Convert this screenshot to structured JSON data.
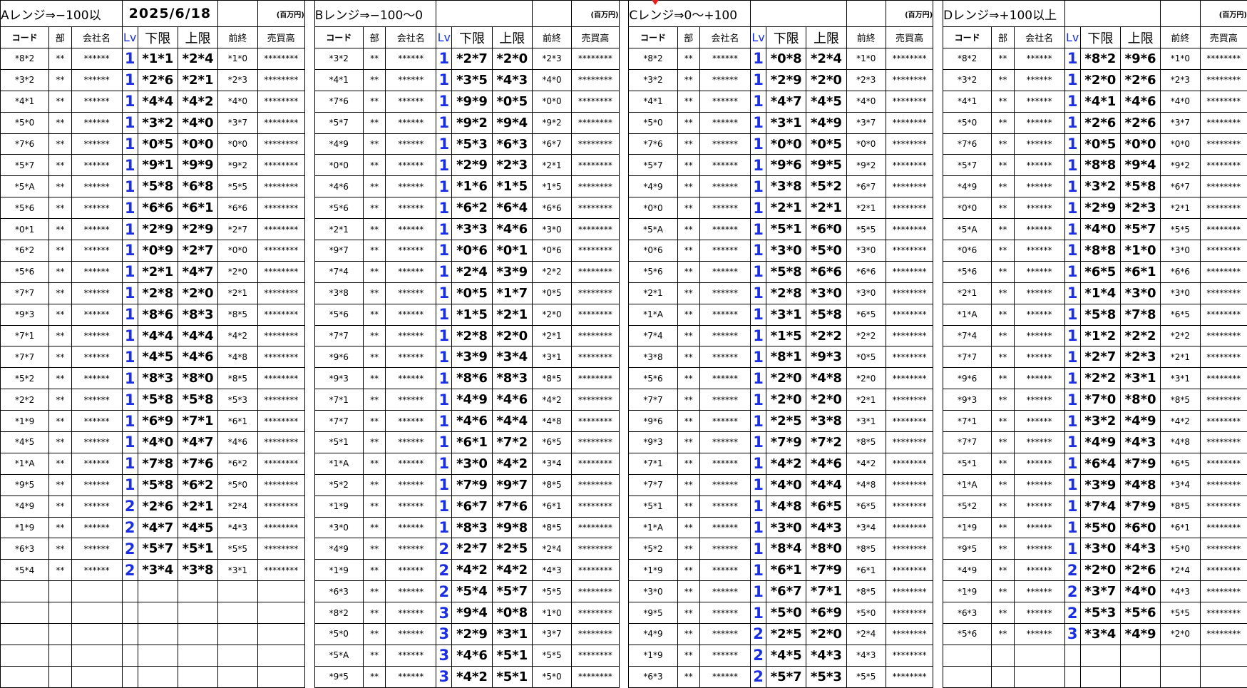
{
  "date": "2025/6/18",
  "unit": "(百万円)",
  "headers": {
    "code": "コード",
    "bu": "部",
    "name": "会社名",
    "lv": "Lv",
    "lo": "下限",
    "hi": "上限",
    "pc": "前終",
    "sale": "売買高"
  },
  "masks": {
    "bu": "**",
    "name": "******",
    "sale": "********"
  },
  "blocks": [
    {
      "title": "Aレンジ⇒−100以",
      "rows": [
        {
          "code": "*8*2",
          "lv": "1",
          "lo": "*1*1",
          "hi": "*2*4",
          "pc": "*1*0"
        },
        {
          "code": "*3*2",
          "lv": "1",
          "lo": "*2*6",
          "hi": "*2*1",
          "pc": "*2*3"
        },
        {
          "code": "*4*1",
          "lv": "1",
          "lo": "*4*4",
          "hi": "*4*2",
          "pc": "*4*0"
        },
        {
          "code": "*5*0",
          "lv": "1",
          "lo": "*3*2",
          "hi": "*4*0",
          "pc": "*3*7"
        },
        {
          "code": "*7*6",
          "lv": "1",
          "lo": "*0*5",
          "hi": "*0*0",
          "pc": "*0*0"
        },
        {
          "code": "*5*7",
          "lv": "1",
          "lo": "*9*1",
          "hi": "*9*9",
          "pc": "*9*2"
        },
        {
          "code": "*5*A",
          "lv": "1",
          "lo": "*5*8",
          "hi": "*6*8",
          "pc": "*5*5"
        },
        {
          "code": "*5*6",
          "lv": "1",
          "lo": "*6*6",
          "hi": "*6*1",
          "pc": "*6*6"
        },
        {
          "code": "*0*1",
          "lv": "1",
          "lo": "*2*9",
          "hi": "*2*9",
          "pc": "*2*7"
        },
        {
          "code": "*6*2",
          "lv": "1",
          "lo": "*0*9",
          "hi": "*2*7",
          "pc": "*0*0"
        },
        {
          "code": "*5*6",
          "lv": "1",
          "lo": "*2*1",
          "hi": "*4*7",
          "pc": "*2*0"
        },
        {
          "code": "*7*7",
          "lv": "1",
          "lo": "*2*8",
          "hi": "*2*0",
          "pc": "*2*1"
        },
        {
          "code": "*9*3",
          "lv": "1",
          "lo": "*8*6",
          "hi": "*8*3",
          "pc": "*8*5"
        },
        {
          "code": "*7*1",
          "lv": "1",
          "lo": "*4*4",
          "hi": "*4*4",
          "pc": "*4*2"
        },
        {
          "code": "*7*7",
          "lv": "1",
          "lo": "*4*5",
          "hi": "*4*6",
          "pc": "*4*8"
        },
        {
          "code": "*5*2",
          "lv": "1",
          "lo": "*8*3",
          "hi": "*8*0",
          "pc": "*8*5"
        },
        {
          "code": "*2*2",
          "lv": "1",
          "lo": "*5*8",
          "hi": "*5*8",
          "pc": "*5*3"
        },
        {
          "code": "*1*9",
          "lv": "1",
          "lo": "*6*9",
          "hi": "*7*1",
          "pc": "*6*1"
        },
        {
          "code": "*4*5",
          "lv": "1",
          "lo": "*4*0",
          "hi": "*4*7",
          "pc": "*4*6"
        },
        {
          "code": "*1*A",
          "lv": "1",
          "lo": "*7*8",
          "hi": "*7*6",
          "pc": "*6*2"
        },
        {
          "code": "*9*5",
          "lv": "1",
          "lo": "*5*8",
          "hi": "*6*2",
          "pc": "*5*0"
        },
        {
          "code": "*4*9",
          "lv": "2",
          "lo": "*2*6",
          "hi": "*2*1",
          "pc": "*2*4"
        },
        {
          "code": "*1*9",
          "lv": "2",
          "lo": "*4*7",
          "hi": "*4*5",
          "pc": "*4*3"
        },
        {
          "code": "*6*3",
          "lv": "2",
          "lo": "*5*7",
          "hi": "*5*1",
          "pc": "*5*5"
        },
        {
          "code": "*5*4",
          "lv": "2",
          "lo": "*3*4",
          "hi": "*3*8",
          "pc": "*3*1"
        }
      ]
    },
    {
      "title": "Bレンジ⇒−100〜0",
      "rows": [
        {
          "code": "*3*2",
          "lv": "1",
          "lo": "*2*7",
          "hi": "*2*0",
          "pc": "*2*3"
        },
        {
          "code": "*4*1",
          "lv": "1",
          "lo": "*3*5",
          "hi": "*4*3",
          "pc": "*4*0"
        },
        {
          "code": "*7*6",
          "lv": "1",
          "lo": "*9*9",
          "hi": "*0*5",
          "pc": "*0*0"
        },
        {
          "code": "*5*7",
          "lv": "1",
          "lo": "*9*2",
          "hi": "*9*4",
          "pc": "*9*2"
        },
        {
          "code": "*4*9",
          "lv": "1",
          "lo": "*5*3",
          "hi": "*6*3",
          "pc": "*6*7"
        },
        {
          "code": "*0*0",
          "lv": "1",
          "lo": "*2*9",
          "hi": "*2*3",
          "pc": "*2*1"
        },
        {
          "code": "*4*6",
          "lv": "1",
          "lo": "*1*6",
          "hi": "*1*5",
          "pc": "*1*5"
        },
        {
          "code": "*5*6",
          "lv": "1",
          "lo": "*6*2",
          "hi": "*6*4",
          "pc": "*6*6"
        },
        {
          "code": "*2*1",
          "lv": "1",
          "lo": "*3*3",
          "hi": "*4*6",
          "pc": "*3*0"
        },
        {
          "code": "*9*7",
          "lv": "1",
          "lo": "*0*6",
          "hi": "*0*1",
          "pc": "*0*6"
        },
        {
          "code": "*7*4",
          "lv": "1",
          "lo": "*2*4",
          "hi": "*3*9",
          "pc": "*2*2"
        },
        {
          "code": "*3*8",
          "lv": "1",
          "lo": "*0*5",
          "hi": "*1*7",
          "pc": "*0*5"
        },
        {
          "code": "*5*6",
          "lv": "1",
          "lo": "*1*5",
          "hi": "*2*1",
          "pc": "*2*0"
        },
        {
          "code": "*7*7",
          "lv": "1",
          "lo": "*2*8",
          "hi": "*2*0",
          "pc": "*2*1"
        },
        {
          "code": "*9*6",
          "lv": "1",
          "lo": "*3*9",
          "hi": "*3*4",
          "pc": "*3*1"
        },
        {
          "code": "*9*3",
          "lv": "1",
          "lo": "*8*6",
          "hi": "*8*3",
          "pc": "*8*5"
        },
        {
          "code": "*7*1",
          "lv": "1",
          "lo": "*4*9",
          "hi": "*4*6",
          "pc": "*4*2"
        },
        {
          "code": "*7*7",
          "lv": "1",
          "lo": "*4*6",
          "hi": "*4*4",
          "pc": "*4*8"
        },
        {
          "code": "*5*1",
          "lv": "1",
          "lo": "*6*1",
          "hi": "*7*2",
          "pc": "*6*5"
        },
        {
          "code": "*1*A",
          "lv": "1",
          "lo": "*3*0",
          "hi": "*4*2",
          "pc": "*3*4"
        },
        {
          "code": "*5*2",
          "lv": "1",
          "lo": "*7*9",
          "hi": "*9*7",
          "pc": "*8*5"
        },
        {
          "code": "*1*9",
          "lv": "1",
          "lo": "*6*7",
          "hi": "*7*6",
          "pc": "*6*1"
        },
        {
          "code": "*3*0",
          "lv": "1",
          "lo": "*8*3",
          "hi": "*9*8",
          "pc": "*8*5"
        },
        {
          "code": "*4*9",
          "lv": "2",
          "lo": "*2*7",
          "hi": "*2*5",
          "pc": "*2*4"
        },
        {
          "code": "*1*9",
          "lv": "2",
          "lo": "*4*2",
          "hi": "*4*2",
          "pc": "*4*3"
        },
        {
          "code": "*6*3",
          "lv": "2",
          "lo": "*5*4",
          "hi": "*5*7",
          "pc": "*5*5"
        },
        {
          "code": "*8*2",
          "lv": "3",
          "lo": "*9*4",
          "hi": "*0*8",
          "pc": "*1*0"
        },
        {
          "code": "*5*0",
          "lv": "3",
          "lo": "*2*9",
          "hi": "*3*1",
          "pc": "*3*7"
        },
        {
          "code": "*5*A",
          "lv": "3",
          "lo": "*4*6",
          "hi": "*5*1",
          "pc": "*5*5"
        },
        {
          "code": "*9*5",
          "lv": "3",
          "lo": "*4*2",
          "hi": "*5*1",
          "pc": "*5*0"
        }
      ]
    },
    {
      "title": "Cレンジ⇒0〜+100",
      "rows": [
        {
          "code": "*8*2",
          "lv": "1",
          "lo": "*0*8",
          "hi": "*2*4",
          "pc": "*1*0"
        },
        {
          "code": "*3*2",
          "lv": "1",
          "lo": "*2*9",
          "hi": "*2*0",
          "pc": "*2*3"
        },
        {
          "code": "*4*1",
          "lv": "1",
          "lo": "*4*7",
          "hi": "*4*5",
          "pc": "*4*0"
        },
        {
          "code": "*5*0",
          "lv": "1",
          "lo": "*3*1",
          "hi": "*4*9",
          "pc": "*3*7"
        },
        {
          "code": "*7*6",
          "lv": "1",
          "lo": "*0*0",
          "hi": "*0*5",
          "pc": "*0*0"
        },
        {
          "code": "*5*7",
          "lv": "1",
          "lo": "*9*6",
          "hi": "*9*5",
          "pc": "*9*2"
        },
        {
          "code": "*4*9",
          "lv": "1",
          "lo": "*3*8",
          "hi": "*5*2",
          "pc": "*6*7"
        },
        {
          "code": "*0*0",
          "lv": "1",
          "lo": "*2*1",
          "hi": "*2*1",
          "pc": "*2*1"
        },
        {
          "code": "*5*A",
          "lv": "1",
          "lo": "*5*1",
          "hi": "*6*0",
          "pc": "*5*5"
        },
        {
          "code": "*0*6",
          "lv": "1",
          "lo": "*3*0",
          "hi": "*5*0",
          "pc": "*3*0"
        },
        {
          "code": "*5*6",
          "lv": "1",
          "lo": "*5*8",
          "hi": "*6*6",
          "pc": "*6*6"
        },
        {
          "code": "*2*1",
          "lv": "1",
          "lo": "*2*8",
          "hi": "*3*0",
          "pc": "*3*0"
        },
        {
          "code": "*1*A",
          "lv": "1",
          "lo": "*3*1",
          "hi": "*5*8",
          "pc": "*6*5"
        },
        {
          "code": "*7*4",
          "lv": "1",
          "lo": "*1*5",
          "hi": "*2*2",
          "pc": "*2*2"
        },
        {
          "code": "*3*8",
          "lv": "1",
          "lo": "*8*1",
          "hi": "*9*3",
          "pc": "*0*5"
        },
        {
          "code": "*5*6",
          "lv": "1",
          "lo": "*2*0",
          "hi": "*4*8",
          "pc": "*2*0"
        },
        {
          "code": "*7*7",
          "lv": "1",
          "lo": "*2*0",
          "hi": "*2*0",
          "pc": "*2*1"
        },
        {
          "code": "*9*6",
          "lv": "1",
          "lo": "*2*5",
          "hi": "*3*8",
          "pc": "*3*1"
        },
        {
          "code": "*9*3",
          "lv": "1",
          "lo": "*7*9",
          "hi": "*7*2",
          "pc": "*8*5"
        },
        {
          "code": "*7*1",
          "lv": "1",
          "lo": "*4*2",
          "hi": "*4*6",
          "pc": "*4*2"
        },
        {
          "code": "*7*7",
          "lv": "1",
          "lo": "*4*0",
          "hi": "*4*4",
          "pc": "*4*8"
        },
        {
          "code": "*5*1",
          "lv": "1",
          "lo": "*4*8",
          "hi": "*6*5",
          "pc": "*6*5"
        },
        {
          "code": "*1*A",
          "lv": "1",
          "lo": "*3*0",
          "hi": "*4*3",
          "pc": "*3*4"
        },
        {
          "code": "*5*2",
          "lv": "1",
          "lo": "*8*4",
          "hi": "*8*0",
          "pc": "*8*5"
        },
        {
          "code": "*1*9",
          "lv": "1",
          "lo": "*6*1",
          "hi": "*7*9",
          "pc": "*6*1"
        },
        {
          "code": "*3*0",
          "lv": "1",
          "lo": "*6*7",
          "hi": "*7*1",
          "pc": "*8*5"
        },
        {
          "code": "*9*5",
          "lv": "1",
          "lo": "*5*0",
          "hi": "*6*9",
          "pc": "*5*0"
        },
        {
          "code": "*4*9",
          "lv": "2",
          "lo": "*2*5",
          "hi": "*2*0",
          "pc": "*2*4"
        },
        {
          "code": "*1*9",
          "lv": "2",
          "lo": "*4*5",
          "hi": "*4*3",
          "pc": "*4*3"
        },
        {
          "code": "*6*3",
          "lv": "2",
          "lo": "*5*7",
          "hi": "*5*3",
          "pc": "*5*5"
        }
      ]
    },
    {
      "title": "Dレンジ⇒+100以上",
      "rows": [
        {
          "code": "*8*2",
          "lv": "1",
          "lo": "*8*2",
          "hi": "*9*6",
          "pc": "*1*0"
        },
        {
          "code": "*3*2",
          "lv": "1",
          "lo": "*2*0",
          "hi": "*2*6",
          "pc": "*2*3"
        },
        {
          "code": "*4*1",
          "lv": "1",
          "lo": "*4*1",
          "hi": "*4*6",
          "pc": "*4*0"
        },
        {
          "code": "*5*0",
          "lv": "1",
          "lo": "*2*6",
          "hi": "*2*6",
          "pc": "*3*7"
        },
        {
          "code": "*7*6",
          "lv": "1",
          "lo": "*0*5",
          "hi": "*0*0",
          "pc": "*0*0"
        },
        {
          "code": "*5*7",
          "lv": "1",
          "lo": "*8*8",
          "hi": "*9*4",
          "pc": "*9*2"
        },
        {
          "code": "*4*9",
          "lv": "1",
          "lo": "*3*2",
          "hi": "*5*8",
          "pc": "*6*7"
        },
        {
          "code": "*0*0",
          "lv": "1",
          "lo": "*2*9",
          "hi": "*2*3",
          "pc": "*2*1"
        },
        {
          "code": "*5*A",
          "lv": "1",
          "lo": "*4*0",
          "hi": "*5*7",
          "pc": "*5*5"
        },
        {
          "code": "*0*6",
          "lv": "1",
          "lo": "*8*8",
          "hi": "*1*0",
          "pc": "*3*0"
        },
        {
          "code": "*5*6",
          "lv": "1",
          "lo": "*6*5",
          "hi": "*6*1",
          "pc": "*6*6"
        },
        {
          "code": "*2*1",
          "lv": "1",
          "lo": "*1*4",
          "hi": "*3*0",
          "pc": "*3*0"
        },
        {
          "code": "*1*A",
          "lv": "1",
          "lo": "*5*8",
          "hi": "*7*8",
          "pc": "*6*5"
        },
        {
          "code": "*7*4",
          "lv": "1",
          "lo": "*1*2",
          "hi": "*2*2",
          "pc": "*2*2"
        },
        {
          "code": "*7*7",
          "lv": "1",
          "lo": "*2*7",
          "hi": "*2*3",
          "pc": "*2*1"
        },
        {
          "code": "*9*6",
          "lv": "1",
          "lo": "*2*2",
          "hi": "*3*1",
          "pc": "*3*1"
        },
        {
          "code": "*9*3",
          "lv": "1",
          "lo": "*7*0",
          "hi": "*8*0",
          "pc": "*8*5"
        },
        {
          "code": "*7*1",
          "lv": "1",
          "lo": "*3*2",
          "hi": "*4*9",
          "pc": "*4*2"
        },
        {
          "code": "*7*7",
          "lv": "1",
          "lo": "*4*9",
          "hi": "*4*3",
          "pc": "*4*8"
        },
        {
          "code": "*5*1",
          "lv": "1",
          "lo": "*6*4",
          "hi": "*7*9",
          "pc": "*6*5"
        },
        {
          "code": "*1*A",
          "lv": "1",
          "lo": "*3*9",
          "hi": "*4*8",
          "pc": "*3*4"
        },
        {
          "code": "*5*2",
          "lv": "1",
          "lo": "*7*4",
          "hi": "*7*9",
          "pc": "*8*5"
        },
        {
          "code": "*1*9",
          "lv": "1",
          "lo": "*5*0",
          "hi": "*6*0",
          "pc": "*6*1"
        },
        {
          "code": "*9*5",
          "lv": "1",
          "lo": "*3*0",
          "hi": "*4*3",
          "pc": "*5*0"
        },
        {
          "code": "*4*9",
          "lv": "2",
          "lo": "*2*0",
          "hi": "*2*6",
          "pc": "*2*4"
        },
        {
          "code": "*1*9",
          "lv": "2",
          "lo": "*3*7",
          "hi": "*4*0",
          "pc": "*4*3"
        },
        {
          "code": "*6*3",
          "lv": "2",
          "lo": "*5*3",
          "hi": "*5*6",
          "pc": "*5*5"
        },
        {
          "code": "*5*6",
          "lv": "3",
          "lo": "*3*4",
          "hi": "*4*9",
          "pc": "*2*0"
        }
      ]
    }
  ]
}
